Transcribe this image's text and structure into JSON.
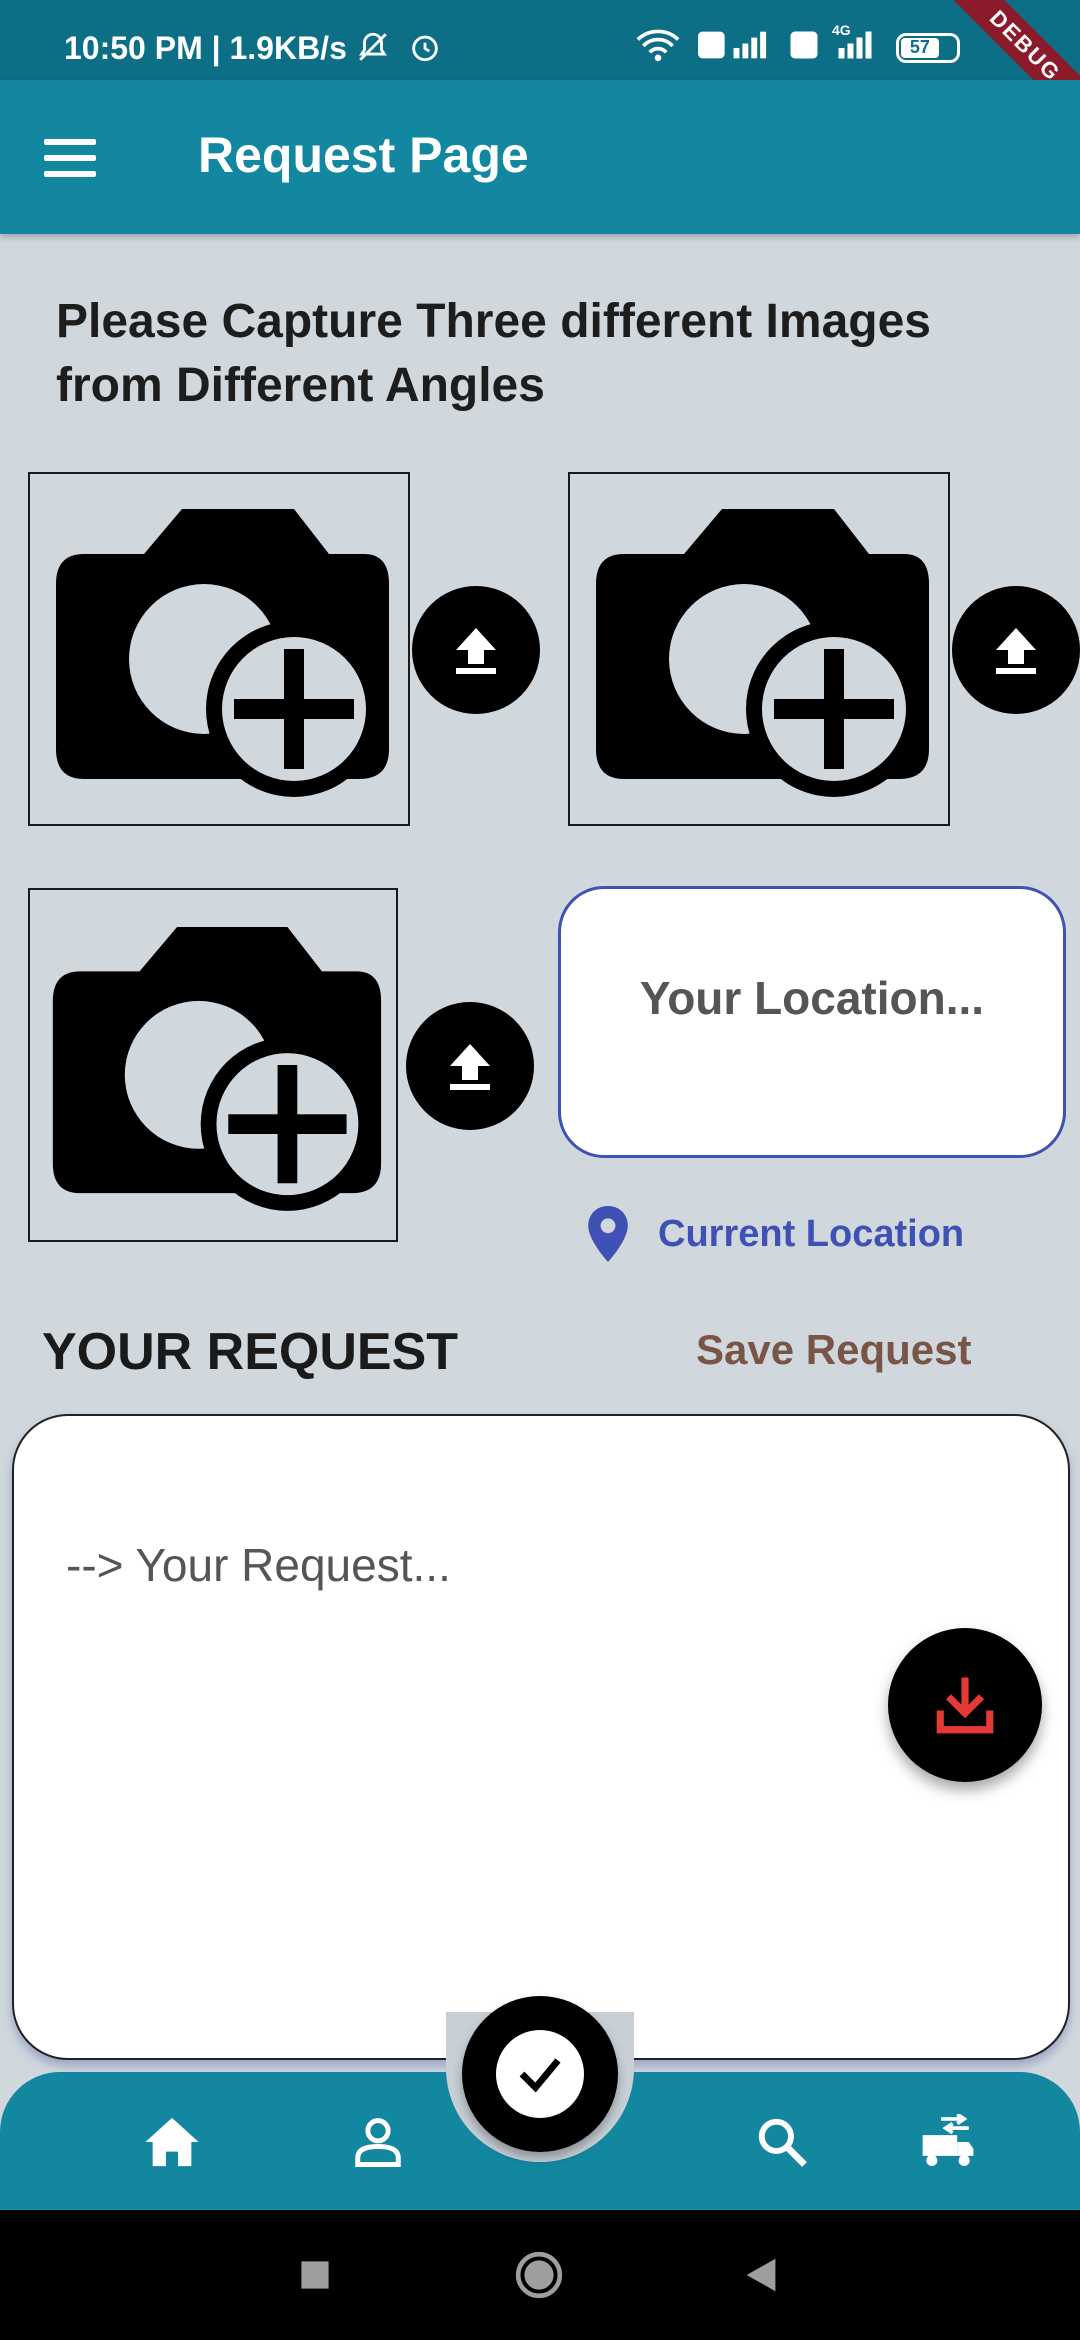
{
  "status_bar": {
    "time_speed": "10:50 PM | 1.9KB/s",
    "battery": "57",
    "debug_label": "DEBUG",
    "network_label": "4G"
  },
  "app_bar": {
    "title": "Request Page"
  },
  "instruction": "Please Capture Three different Images from Different Angles",
  "location": {
    "placeholder": "Your Location...",
    "current_location_label": "Current Location"
  },
  "request": {
    "title": "YOUR REQUEST",
    "save_label": "Save Request",
    "placeholder": "--> Your Request..."
  },
  "colors": {
    "app_bar": "#12879f",
    "status_bar": "#0d6f86",
    "background": "#d0d8de",
    "accent_blue": "#3f51b5",
    "save_brown": "#795548",
    "download_red": "#e53935"
  },
  "bottom_nav": {
    "items": [
      "home-icon",
      "person-icon",
      "check-icon",
      "search-icon",
      "transport-icon"
    ]
  }
}
